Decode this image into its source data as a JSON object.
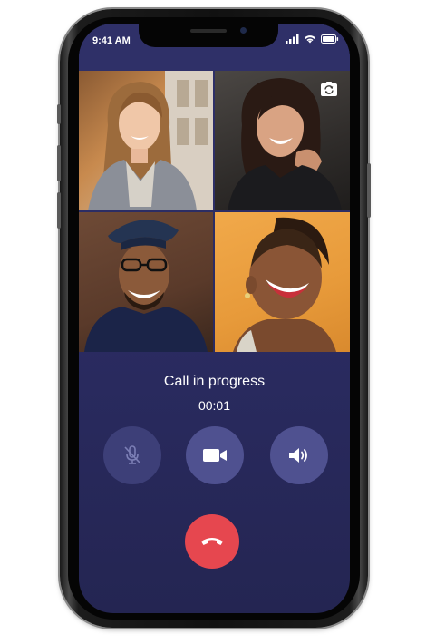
{
  "status_bar": {
    "time": "9:41 AM",
    "icons": [
      "cellular-signal-icon",
      "wifi-icon",
      "battery-icon"
    ]
  },
  "participants": [
    {
      "name": "participant-1",
      "desc": "woman with long hair"
    },
    {
      "name": "participant-2",
      "desc": "woman laughing"
    },
    {
      "name": "participant-3",
      "desc": "man with beret and glasses"
    },
    {
      "name": "participant-4",
      "desc": "woman laughing on orange background"
    }
  ],
  "call": {
    "status": "Call in progress",
    "duration": "00:01"
  },
  "controls": {
    "mute_icon": "microphone-off-icon",
    "video_icon": "video-camera-icon",
    "speaker_icon": "speaker-volume-icon",
    "end_icon": "phone-hangup-icon",
    "switch_camera_icon": "camera-switch-icon"
  },
  "colors": {
    "screen_bg": "#2b2c63",
    "button_bg": "#4f5190",
    "muted_button_bg": "#3d3f78",
    "end_call": "#e6474f"
  }
}
